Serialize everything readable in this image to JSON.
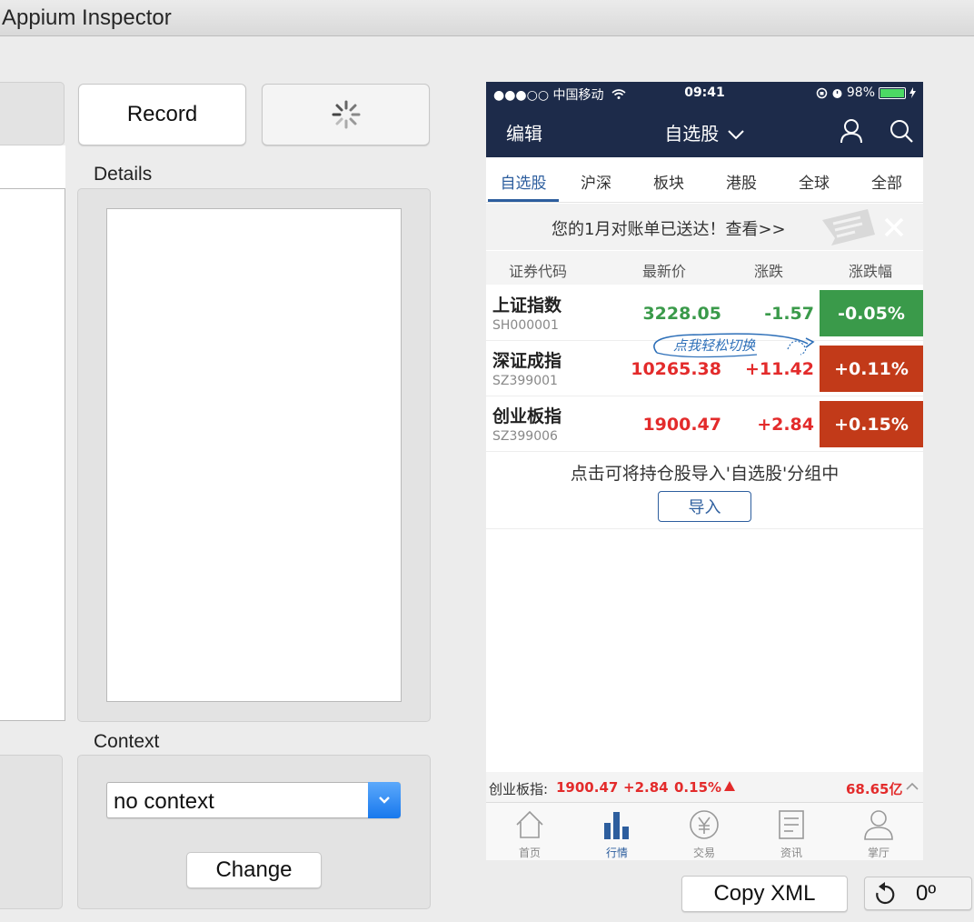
{
  "window": {
    "title": "Appium Inspector"
  },
  "toolbar": {
    "record_label": "Record"
  },
  "details": {
    "label": "Details"
  },
  "context": {
    "label": "Context",
    "selected": "no context",
    "change_label": "Change"
  },
  "bottom": {
    "copy_xml_label": "Copy XML",
    "rotation_label": "0º"
  },
  "device": {
    "status": {
      "carrier": "●●●○○ 中国移动",
      "time": "09:41",
      "battery": "98%"
    },
    "nav": {
      "edit": "编辑",
      "title": "自选股"
    },
    "tabs": [
      "自选股",
      "沪深",
      "板块",
      "港股",
      "全球",
      "全部"
    ],
    "banner": "您的1月对账单已送达！查看>>",
    "columns": [
      "证券代码",
      "最新价",
      "涨跌",
      "涨跌幅"
    ],
    "rows": [
      {
        "name": "上证指数",
        "code": "SH000001",
        "price": "3228.05",
        "change": "-1.57",
        "percent": "-0.05%"
      },
      {
        "name": "深证成指",
        "code": "SZ399001",
        "price": "10265.38",
        "change": "+11.42",
        "percent": "+0.11%"
      },
      {
        "name": "创业板指",
        "code": "SZ399006",
        "price": "1900.47",
        "change": "+2.84",
        "percent": "+0.15%"
      }
    ],
    "swipe_hint": "点我轻松切换",
    "import": {
      "hint": "点击可将持仓股导入'自选股'分组中",
      "button": "导入"
    },
    "ticker": {
      "name": "创业板指:",
      "price": "1900.47",
      "change": "+2.84",
      "percent": "0.15%",
      "volume": "68.65亿"
    },
    "tabbar": [
      "首页",
      "行情",
      "交易",
      "资讯",
      "掌厅"
    ],
    "colors": {
      "nav_bg": "#1d2b4a",
      "up": "#c23a19",
      "down": "#3a9a4a",
      "accent": "#2d5e9e"
    }
  }
}
